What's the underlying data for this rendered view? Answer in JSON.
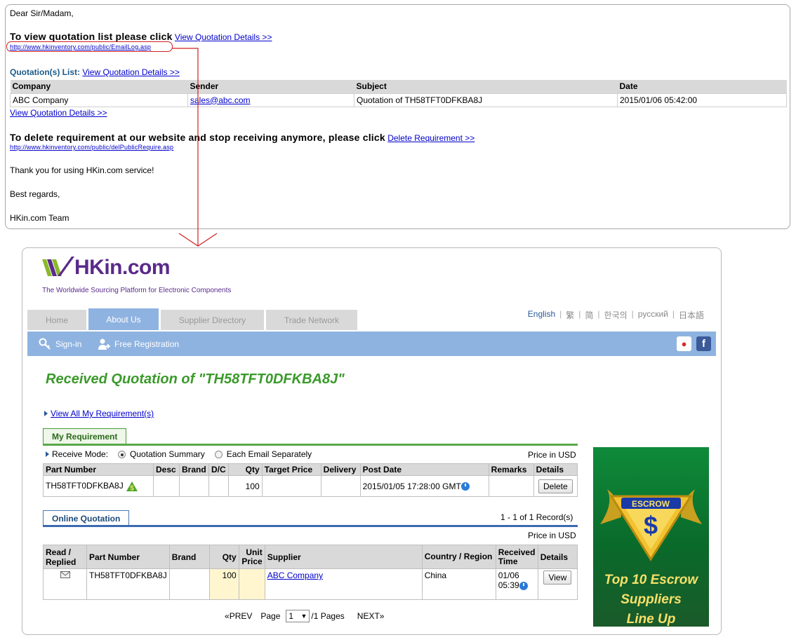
{
  "email": {
    "greeting": "Dear Sir/Madam,",
    "view_list_text": "To view quotation list please click",
    "view_details_link": "View Quotation Details >>",
    "emaillog_url": "http://www.hkinventory.com/public/EmailLog.asp",
    "quotation_list_label": "Quotation(s) List:",
    "table": {
      "headers": [
        "Company",
        "Sender",
        "Subject",
        "Date"
      ],
      "rows": [
        [
          "ABC Company",
          "sales@abc.com",
          "Quotation of TH58TFT0DFKBA8J",
          "2015/01/06 05:42:00"
        ]
      ]
    },
    "delete_text": "To delete requirement at our website and stop receiving anymore, please click",
    "delete_link": "Delete Requirement >>",
    "delete_url": "http://www.hkinventory.com/public/delPublicRequire.asp",
    "thanks": "Thank you for using HKin.com service!",
    "regards": "Best regards,",
    "team": "HKin.com Team"
  },
  "site": {
    "logo_text": "HKin.com",
    "tagline": "The Worldwide Sourcing Platform for Electronic Components",
    "tabs": [
      {
        "label": "Home",
        "active": false
      },
      {
        "label": "About Us",
        "active": true
      },
      {
        "label": "Supplier Directory",
        "active": false
      },
      {
        "label": "Trade Network",
        "active": false
      }
    ],
    "languages": [
      "English",
      "繁",
      "简",
      "한국의",
      "русский",
      "日本語"
    ],
    "signin": "Sign-in",
    "free_registration": "Free Registration",
    "social_icons": [
      "weibo-icon",
      "facebook-icon"
    ],
    "accent_color": "#8fb3e0",
    "title_color": "#3a9a2a"
  },
  "page": {
    "title": "Received Quotation of \"TH58TFT0DFKBA8J\"",
    "view_all_link": "View All My Requirement(s)",
    "my_requirement_tab": "My Requirement",
    "receive_mode_label": "Receive Mode:",
    "receive_options": [
      "Quotation Summary",
      "Each Email Separately"
    ],
    "price_in": "Price in USD",
    "req_table": {
      "headers": [
        "Part Number",
        "Desc",
        "Brand",
        "D/C",
        "Qty",
        "Target Price",
        "Delivery",
        "Post Date",
        "Remarks",
        "Details"
      ],
      "row": {
        "part_number": "TH58TFT0DFKBA8J",
        "desc": "",
        "brand": "",
        "dc": "",
        "qty": "100",
        "target_price": "",
        "delivery": "",
        "post_date": "2015/01/05 17:28:00 GMT",
        "remarks": "",
        "button": "Delete"
      }
    },
    "online_quotation_tab": "Online Quotation",
    "records": "1 - 1 of 1 Record(s)",
    "quote_table": {
      "headers": [
        "Read / Replied",
        "Part Number",
        "Brand",
        "Qty",
        "Unit Price",
        "Supplier",
        "Country / Region",
        "Received Time",
        "Details"
      ],
      "row": {
        "part_number": "TH58TFT0DFKBA8J",
        "brand": "",
        "qty": "100",
        "unit_price": "",
        "supplier": "ABC Company",
        "country": "China",
        "received_date": "01/06",
        "received_time": "05:39",
        "button": "View"
      }
    },
    "pager": {
      "prev": "PREV",
      "page_label": "Page",
      "page_value": "1",
      "pages_suffix": "/1 Pages",
      "next": "NEXT"
    },
    "banner": {
      "escrow_label": "ESCROW",
      "line1": "Top 10 Escrow",
      "line2": "Suppliers",
      "line3": "Line Up"
    }
  }
}
